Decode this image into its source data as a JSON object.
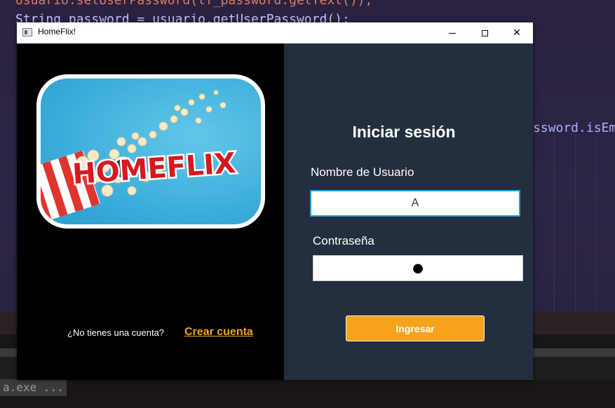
{
  "background_editor": {
    "line1": "Usuario.setUserPassword(tf_password.getText());",
    "line2": "String password = usuario.getUserPassword();",
    "line3": "ssword.isEmp",
    "console": "a.exe ..."
  },
  "window": {
    "title": "HomeFlix!",
    "minimize_icon": "minimize-icon",
    "maximize_icon": "maximize-icon",
    "close_icon": "close-icon"
  },
  "logo": {
    "text": "HOMEFLIX"
  },
  "left": {
    "no_account_text": "¿No tienes una cuenta?",
    "create_account_link": "Crear cuenta"
  },
  "login": {
    "title": "Iniciar sesión",
    "username_label": "Nombre de Usuario",
    "username_value": "A",
    "password_label": "Contraseña",
    "password_value": "●",
    "submit_label": "Ingresar"
  },
  "colors": {
    "accent": "#f7a21d",
    "right_panel_bg": "#232f3e",
    "focus_border": "#2a9fe0"
  }
}
